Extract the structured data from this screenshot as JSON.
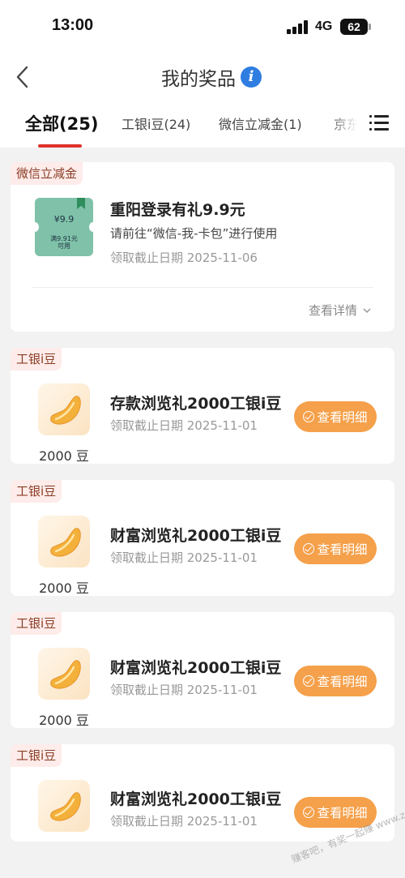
{
  "status_bar": {
    "time": "13:00",
    "network": "4G",
    "battery": "62"
  },
  "nav": {
    "title": "我的奖品",
    "info_icon": "i"
  },
  "tabs": [
    {
      "label": "全部(25)",
      "active": true
    },
    {
      "label": "工银i豆(24)",
      "active": false
    },
    {
      "label": "微信立减金(1)",
      "active": false
    },
    {
      "label": "京东",
      "active": false
    }
  ],
  "coupon_card": {
    "tag": "微信立减金",
    "thumb_amount": "¥9.9",
    "thumb_condition": "满9.91元\n可用",
    "title": "重阳登录有礼9.9元",
    "description": "请前往“微信-我-卡包”进行使用",
    "deadline": "领取截止日期 2025-11-06",
    "details_label": "查看详情"
  },
  "bean_cards": [
    {
      "tag": "工银i豆",
      "title": "存款浏览礼2000工银i豆",
      "deadline": "领取截止日期 2025-11-01",
      "amount": "2000 豆",
      "button": "查看明细"
    },
    {
      "tag": "工银i豆",
      "title": "财富浏览礼2000工银i豆",
      "deadline": "领取截止日期 2025-11-01",
      "amount": "2000 豆",
      "button": "查看明细"
    },
    {
      "tag": "工银i豆",
      "title": "财富浏览礼2000工银i豆",
      "deadline": "领取截止日期 2025-11-01",
      "amount": "2000 豆",
      "button": "查看明细"
    },
    {
      "tag": "工银i豆",
      "title": "财富浏览礼2000工银i豆",
      "deadline": "领取截止日期 2025-11-01",
      "amount": "",
      "button": "查看明细"
    }
  ],
  "watermark": "赚客吧，有奖一起赚 www.zuanke8.com",
  "colors": {
    "accent": "#e0322a",
    "button": "#f5a04a",
    "info": "#2f7de1",
    "coupon": "#7fc2a9"
  }
}
